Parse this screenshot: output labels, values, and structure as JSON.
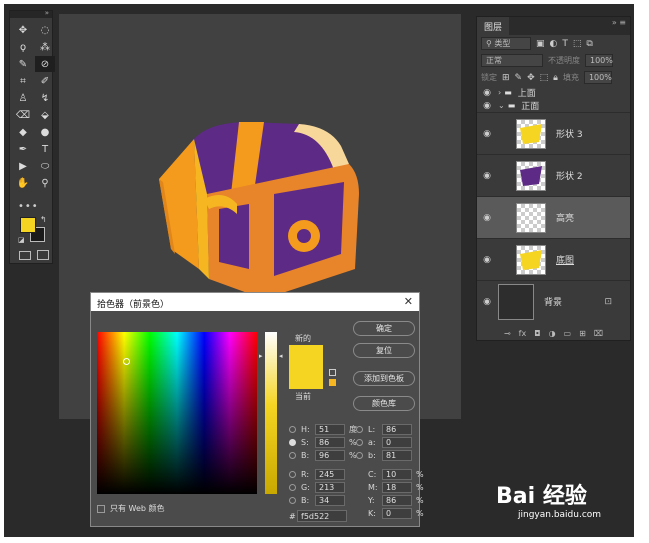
{
  "colors": {
    "foreground": "#f5d522",
    "accent_orange": "#f49a1c",
    "chest_purple": "#5d2a86"
  },
  "toolbar": {
    "collapse": "»",
    "tools": [
      {
        "name": "move-tool",
        "glyph": "✥",
        "selected": false
      },
      {
        "name": "marquee-tool",
        "glyph": "◌",
        "selected": false
      },
      {
        "name": "lasso-tool",
        "glyph": "ϙ",
        "selected": false
      },
      {
        "name": "magic-wand-tool",
        "glyph": "⁂",
        "selected": false
      },
      {
        "name": "brush-tool",
        "glyph": "✎",
        "selected": false
      },
      {
        "name": "eyedropper-tool",
        "glyph": "⊘",
        "selected": true
      },
      {
        "name": "crop-tool",
        "glyph": "⌗",
        "selected": false
      },
      {
        "name": "healing-tool",
        "glyph": "✐",
        "selected": false
      },
      {
        "name": "stamp-tool",
        "glyph": "♙",
        "selected": false
      },
      {
        "name": "history-brush-tool",
        "glyph": "↯",
        "selected": false
      },
      {
        "name": "eraser-tool",
        "glyph": "⌫",
        "selected": false
      },
      {
        "name": "bucket-tool",
        "glyph": "⬙",
        "selected": false
      },
      {
        "name": "blur-tool",
        "glyph": "◆",
        "selected": false
      },
      {
        "name": "dodge-tool",
        "glyph": "●",
        "selected": false
      },
      {
        "name": "pen-tool",
        "glyph": "✒",
        "selected": false
      },
      {
        "name": "type-tool",
        "glyph": "T",
        "selected": false
      },
      {
        "name": "path-select-tool",
        "glyph": "▶",
        "selected": false
      },
      {
        "name": "shape-tool",
        "glyph": "⬭",
        "selected": false
      },
      {
        "name": "hand-tool",
        "glyph": "✋",
        "selected": false
      },
      {
        "name": "zoom-tool",
        "glyph": "⚲",
        "selected": false
      }
    ],
    "more": "•••"
  },
  "layers_panel": {
    "tab": "图层",
    "close": "» ≡",
    "search_placeholder": "类型",
    "blend_mode": "正常",
    "opacity_label": "不透明度",
    "opacity_value": "100%",
    "lock_label": "锁定",
    "fill_label": "填充",
    "fill_value": "100%",
    "groups": [
      {
        "name": "上面",
        "expanded": false
      },
      {
        "name": "正面",
        "expanded": true
      }
    ],
    "layers": [
      {
        "name": "形状 3",
        "kind": "shape-yellow",
        "active": false,
        "underline": false
      },
      {
        "name": "形状 2",
        "kind": "shape-purple",
        "active": false,
        "underline": false
      },
      {
        "name": "高亮",
        "kind": "empty",
        "active": true,
        "underline": false
      },
      {
        "name": "底图",
        "kind": "shape-yellow",
        "active": false,
        "underline": true
      },
      {
        "name": "背景",
        "kind": "background",
        "active": false,
        "underline": false
      }
    ],
    "footer_icons": [
      "link-icon",
      "fx-icon",
      "mask-icon",
      "adjustment-icon",
      "folder-icon",
      "new-layer-icon",
      "trash-icon"
    ]
  },
  "color_picker": {
    "title": "拾色器（前景色）",
    "close": "✕",
    "new_label": "新的",
    "current_label": "当前",
    "buttons": {
      "ok": "确定",
      "reset": "复位",
      "add_swatch": "添加到色板",
      "libraries": "颜色库"
    },
    "hsb": [
      {
        "label": "H:",
        "value": "51",
        "unit": "度",
        "selected": false
      },
      {
        "label": "S:",
        "value": "86",
        "unit": "%",
        "selected": true
      },
      {
        "label": "B:",
        "value": "96",
        "unit": "%",
        "selected": false
      }
    ],
    "rgb": [
      {
        "label": "R:",
        "value": "245",
        "selected": false
      },
      {
        "label": "G:",
        "value": "213",
        "selected": false
      },
      {
        "label": "B:",
        "value": "34",
        "selected": false
      }
    ],
    "lab": [
      {
        "label": "L:",
        "value": "86",
        "selected": false
      },
      {
        "label": "a:",
        "value": "0",
        "selected": false
      },
      {
        "label": "b:",
        "value": "81",
        "selected": false
      }
    ],
    "cmyk": [
      {
        "label": "C:",
        "value": "10",
        "unit": "%"
      },
      {
        "label": "M:",
        "value": "18",
        "unit": "%"
      },
      {
        "label": "Y:",
        "value": "86",
        "unit": "%"
      },
      {
        "label": "K:",
        "value": "0",
        "unit": "%"
      }
    ],
    "hex_label": "#",
    "hex": "f5d522",
    "web_only": "只有 Web 颜色"
  },
  "watermark": {
    "brand": "Bai 经验",
    "url": "jingyan.baidu.com"
  }
}
